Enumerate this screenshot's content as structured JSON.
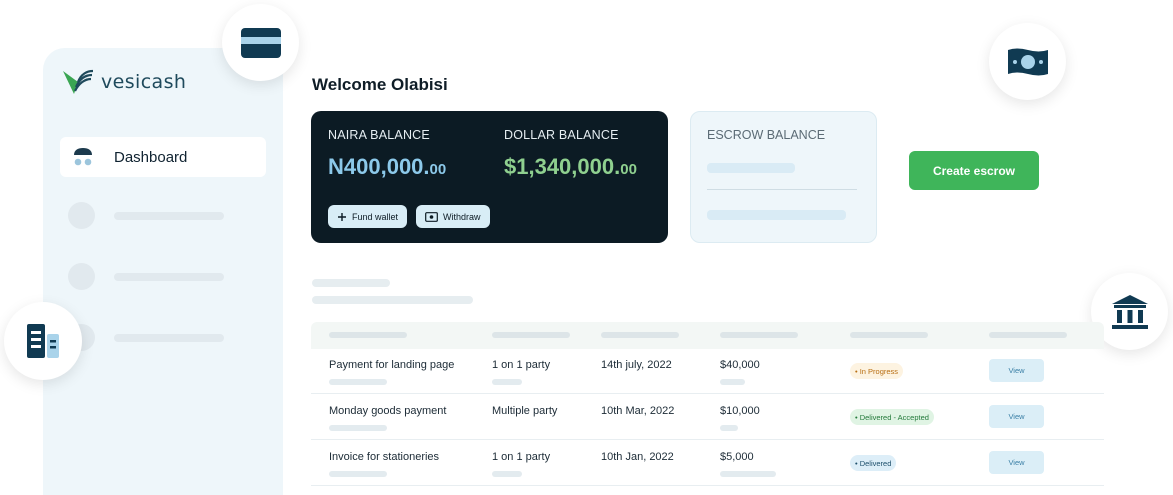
{
  "brand": {
    "name": "vesicash"
  },
  "sidebar": {
    "active_item": {
      "label": "Dashboard",
      "icon": "dashboard-icon"
    }
  },
  "welcome": "Welcome Olabisi",
  "balances": {
    "naira": {
      "label": "NAIRA BALANCE",
      "amount_main": "N400,000.",
      "amount_decimal": "00"
    },
    "dollar": {
      "label": "DOLLAR BALANCE",
      "amount_main": "$1,340,000.",
      "amount_decimal": "00"
    },
    "fund_wallet_label": "Fund wallet",
    "withdraw_label": "Withdraw"
  },
  "escrow": {
    "label": "ESCROW BALANCE"
  },
  "create_escrow_label": "Create escrow",
  "transactions": {
    "rows": [
      {
        "description": "Payment for landing page",
        "party": "1 on 1 party",
        "date": "14th july, 2022",
        "amount": "$40,000",
        "status": "• In Progress",
        "action": "View"
      },
      {
        "description": "Monday goods payment",
        "party": "Multiple party",
        "date": "10th Mar, 2022",
        "amount": "$10,000",
        "status": "• Delivered - Accepted",
        "action": "View"
      },
      {
        "description": "Invoice for stationeries",
        "party": "1 on 1 party",
        "date": "10th Jan, 2022",
        "amount": "$5,000",
        "status": "• Delivered",
        "action": "View"
      }
    ]
  },
  "colors": {
    "balance_card_bg": "#0c1b24",
    "naira_amount": "#8cc9ea",
    "dollar_amount": "#8fd08f",
    "primary_green": "#3fb55a",
    "status_in_progress": "#fdf3e1",
    "status_delivered_accepted": "#e0f4e4",
    "status_delivered": "#ddeef8"
  },
  "decorative_icons": [
    "card-icon",
    "cash-icon",
    "bank-icon",
    "document-icon"
  ]
}
